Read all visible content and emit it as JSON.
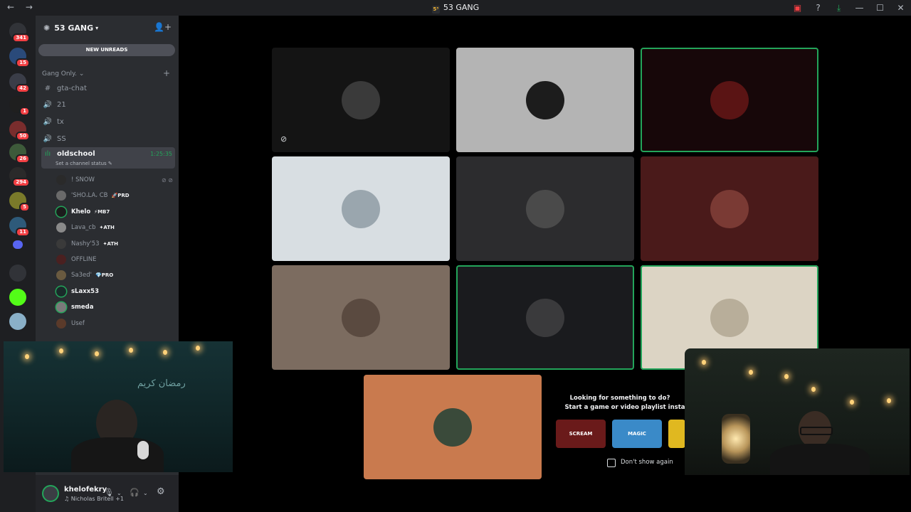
{
  "titlebar": {
    "title": "53 GANG",
    "guild_icon_text": "5³",
    "nav": "← →"
  },
  "guild": {
    "name": "53 GANG",
    "new_unreads": "NEW UNREADS",
    "category": "Gang Only."
  },
  "servers": [
    {
      "badge": "341",
      "color": "#313338"
    },
    {
      "badge": "15",
      "color": "#2a4a7a"
    },
    {
      "badge": "42",
      "color": "#3a3d48"
    },
    {
      "badge": "1",
      "color": "#1f1f1f"
    },
    {
      "badge": "50",
      "color": "#7a2d2d"
    },
    {
      "badge": "26",
      "color": "#3d5a3a"
    },
    {
      "badge": "294",
      "color": "#2a2a2a"
    },
    {
      "badge": "5",
      "color": "#7a7a2a"
    },
    {
      "badge": "11",
      "color": "#2e5a7a"
    },
    {
      "badge": "",
      "color": "#5865f2"
    },
    {
      "badge": "",
      "color": "#313338"
    },
    {
      "badge": "",
      "color": "#53fc18"
    },
    {
      "badge": "",
      "color": "#8ab0c8"
    }
  ],
  "channels": [
    {
      "icon": "#",
      "name": "gta-chat"
    },
    {
      "icon": "🔊",
      "name": "21"
    },
    {
      "icon": "🔊",
      "name": "tx"
    },
    {
      "icon": "🔊",
      "name": "SS"
    }
  ],
  "active_channel": {
    "name": "oldschool",
    "status": "Set a channel status ✎",
    "timer": "1:25:35"
  },
  "members": [
    {
      "name": "! SNOW",
      "tag": "",
      "bright": false
    },
    {
      "name": "'SHO،LA، CB",
      "tag": "🚀PRD",
      "bright": false
    },
    {
      "name": "Khelo",
      "tag": "⚡MB7",
      "bright": true
    },
    {
      "name": "Lava_cb",
      "tag": "✦ATH",
      "bright": false
    },
    {
      "name": "Nashy'53",
      "tag": "✦ATH",
      "bright": false
    },
    {
      "name": "OFFLINE",
      "tag": "",
      "bright": false
    },
    {
      "name": "Sa3ed'",
      "tag": "💎PRO",
      "bright": false
    },
    {
      "name": "sLaxx53",
      "tag": "",
      "bright": true
    },
    {
      "name": "smeda",
      "tag": "",
      "bright": true
    },
    {
      "name": "Usef",
      "tag": "",
      "bright": false
    }
  ],
  "user": {
    "name": "khelofekry",
    "activity": "Nicholas Britell +1"
  },
  "tiles": [
    {
      "bg": "#141414",
      "av": "#3a3a3a",
      "speaking": false,
      "muted": true
    },
    {
      "bg": "#b4b4b4",
      "av": "#1c1c1c",
      "speaking": false,
      "muted": false
    },
    {
      "bg": "#170709",
      "av": "#5a1414",
      "speaking": true,
      "muted": false
    },
    {
      "bg": "#d8dee2",
      "av": "#9aa6ae",
      "speaking": false,
      "muted": false
    },
    {
      "bg": "#2c2c2e",
      "av": "#4a4a4a",
      "speaking": false,
      "muted": false
    },
    {
      "bg": "#4a1a1a",
      "av": "#7a3a34",
      "speaking": false,
      "muted": false
    },
    {
      "bg": "#7c6c60",
      "av": "#5a4a40",
      "speaking": false,
      "muted": false
    },
    {
      "bg": "#1a1b1e",
      "av": "#3a3a3c",
      "speaking": true,
      "muted": false
    },
    {
      "bg": "#dcd4c4",
      "av": "#b8ae9a",
      "speaking": true,
      "muted": false
    },
    {
      "bg": "#c97a4e",
      "av": "#3a4a3a",
      "speaking": false,
      "muted": false
    }
  ],
  "activity": {
    "line1": "Looking for something to do?",
    "line2": "Start a game or video playlist instan",
    "games": [
      {
        "label": "SCREAM",
        "color": "#6a1a1a"
      },
      {
        "label": "MAGIC",
        "color": "#3a8ac8"
      },
      {
        "label": "",
        "color": "#e0b820"
      }
    ],
    "dont_show": "Don't show again"
  },
  "webcam_left_text": "رمضان كريم"
}
